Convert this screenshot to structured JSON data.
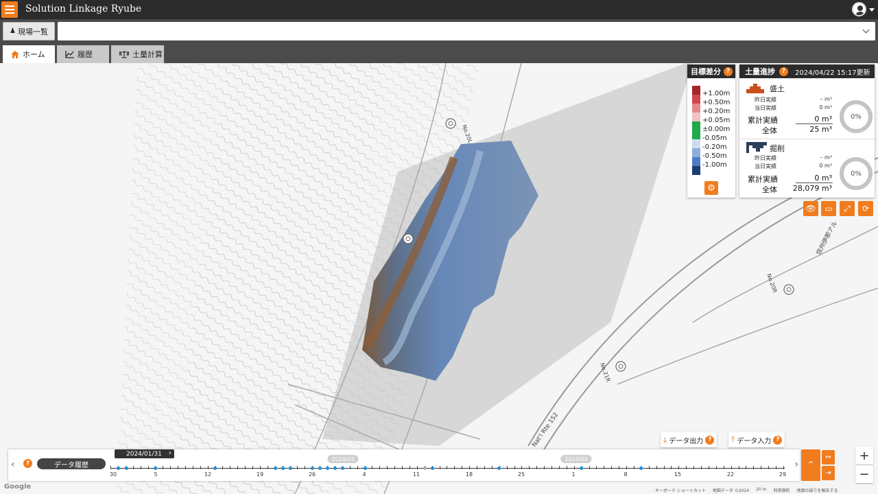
{
  "app": {
    "title": "Solution Linkage Ryube"
  },
  "site_bar": {
    "site_list_label": "現場一覧",
    "site_select_value": ""
  },
  "tabs": [
    {
      "label": "ホーム",
      "icon": "home-icon",
      "active": true
    },
    {
      "label": "履歴",
      "icon": "chart-line-icon",
      "active": false
    },
    {
      "label": "土量計算",
      "icon": "scale-icon",
      "active": false
    }
  ],
  "legend": {
    "title": "目標差分",
    "help": "?",
    "labels": [
      "+1.00m",
      "+0.50m",
      "+0.20m",
      "+0.05m",
      "±0.00m",
      "-0.05m",
      "-0.20m",
      "-0.50m",
      "-1.00m"
    ],
    "colors": [
      "#a3262a",
      "#d2474b",
      "#e38a8c",
      "#efc3c4",
      "#1faa4b",
      "#1faa4b",
      "#cfdcf0",
      "#8eaedd",
      "#4d7cc6",
      "#1c3c73"
    ]
  },
  "progress": {
    "title": "土量進捗",
    "help": "?",
    "updated": "2024/04/22 15:17更新",
    "fill": {
      "title": "盛土",
      "yesterday_label": "昨日実績",
      "yesterday_value": "– m³",
      "today_label": "当日実績",
      "today_value": "0 m³",
      "cumulative_label": "累計実績",
      "cumulative_value": "0 m³",
      "total_label": "全体",
      "total_value": "25 m³",
      "percent": "0%"
    },
    "cut": {
      "title": "掘削",
      "yesterday_label": "昨日実績",
      "yesterday_value": "– m³",
      "today_label": "当日実績",
      "today_value": "0 m³",
      "cumulative_label": "累計実績",
      "cumulative_value": "0 m³",
      "total_label": "全体",
      "total_value": "28,079 m³",
      "percent": "0%"
    }
  },
  "map_tools": [
    "eye-icon",
    "ruler-icon",
    "fullscreen-icon",
    "reset-icon"
  ],
  "map_labels": {
    "road_label": "Nat'l Rte 152",
    "chainage_1": "No.20L",
    "chainage_2": "No.21R",
    "chainage_3": "No.20R",
    "road_name": "信州伊那アル"
  },
  "data_buttons": {
    "export_label": "データ出力",
    "import_label": "データ入力"
  },
  "timeline": {
    "history_label": "データ履歴",
    "current_date": "2024/01/31",
    "months": [
      {
        "label": "2024/03"
      },
      {
        "label": "2024/04"
      }
    ],
    "tick_labels": [
      "30",
      "5",
      "12",
      "19",
      "26",
      "4",
      "11",
      "18",
      "25",
      "1",
      "8",
      "15",
      "22",
      "29"
    ]
  },
  "zoom": {
    "in": "+",
    "out": "−"
  },
  "footer": {
    "google": "Google",
    "keyboard": "キーボード ショートカット",
    "map_data": "地図データ ©2024",
    "scale": "20 m",
    "terms": "利用規約",
    "report": "地図の誤りを報告する"
  }
}
